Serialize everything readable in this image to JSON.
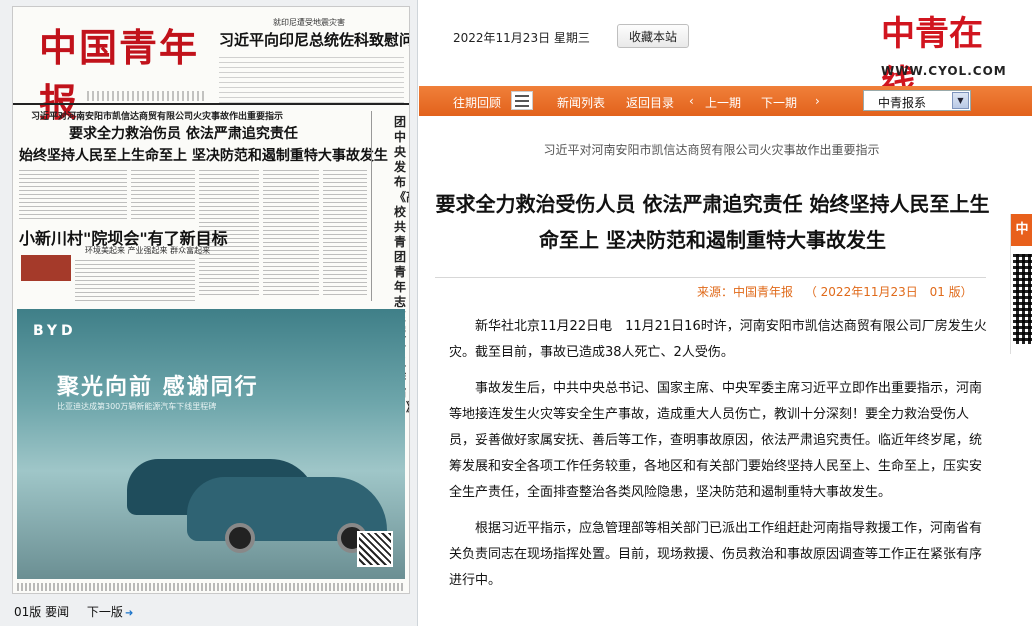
{
  "newspaper_page": {
    "masthead": "中国青年报",
    "top_kicker": "就印尼遭受地震灾害",
    "top_headline": "习近平向印尼总统佐科致慰问电",
    "lead_kicker": "习近平对河南安阳市凯信达商贸有限公司火灾事故作出重要指示",
    "lead_headline_1": "要求全力救治伤员 依法严肃追究责任",
    "lead_headline_2": "始终坚持人民至上生命至上 坚决防范和遏制重特大事故发生",
    "column_title": "团中央发布《高校共青团青年志愿服务工作指引》",
    "sub_headline": "小新川村\"院坝会\"有了新目标",
    "sub_subline": "环境美起来 产业强起来 群众富起来",
    "ad_brand": "BYD",
    "ad_line1": "聚光向前 感谢同行",
    "ad_line2": "比亚迪达成第300万辆新能源汽车下线里程碑"
  },
  "page_nav": {
    "current": "01版 要闻",
    "next": "下一版"
  },
  "topbar": {
    "date": "2022年11月23日 星期三",
    "favorite_button": "收藏本站",
    "logo_cn": "中青在线",
    "logo_en": "WWW.CYOL.COM"
  },
  "navbar": {
    "items": [
      "往期回顾",
      "新闻列表",
      "返回目录",
      "上一期",
      "下一期"
    ],
    "select_value": "中青报系",
    "prev_arrow": "‹",
    "next_arrow": "›"
  },
  "article": {
    "kicker": "习近平对河南安阳市凯信达商贸有限公司火灾事故作出重要指示",
    "title": "要求全力救治受伤人员 依法严肃追究责任 始终坚持人民至上生命至上 坚决防范和遏制重特大事故发生",
    "source_label": "来源：中国青年报",
    "source_date": "（ 2022年11月23日",
    "source_page": "01 版）",
    "paragraphs": [
      "新华社北京11月22日电　11月21日16时许，河南安阳市凯信达商贸有限公司厂房发生火灾。截至目前，事故已造成38人死亡、2人受伤。",
      "事故发生后，中共中央总书记、国家主席、中央军委主席习近平立即作出重要指示，河南等地接连发生火灾等安全生产事故，造成重大人员伤亡，教训十分深刻！要全力救治受伤人员，妥善做好家属安抚、善后等工作，查明事故原因，依法严肃追究责任。临近年终岁尾，统筹发展和安全各项工作任务较重，各地区和有关部门要始终坚持人民至上、生命至上，压实安全生产责任，全面排查整治各类风险隐患，坚决防范和遏制重特大事故发生。",
      "根据习近平指示，应急管理部等相关部门已派出工作组赶赴河南指导救援工作，河南省有关负责同志在现场指挥处置。目前，现场救援、伤员救治和事故原因调查等工作正在紧张有序进行中。"
    ]
  },
  "side_tab": {
    "label": "中"
  }
}
